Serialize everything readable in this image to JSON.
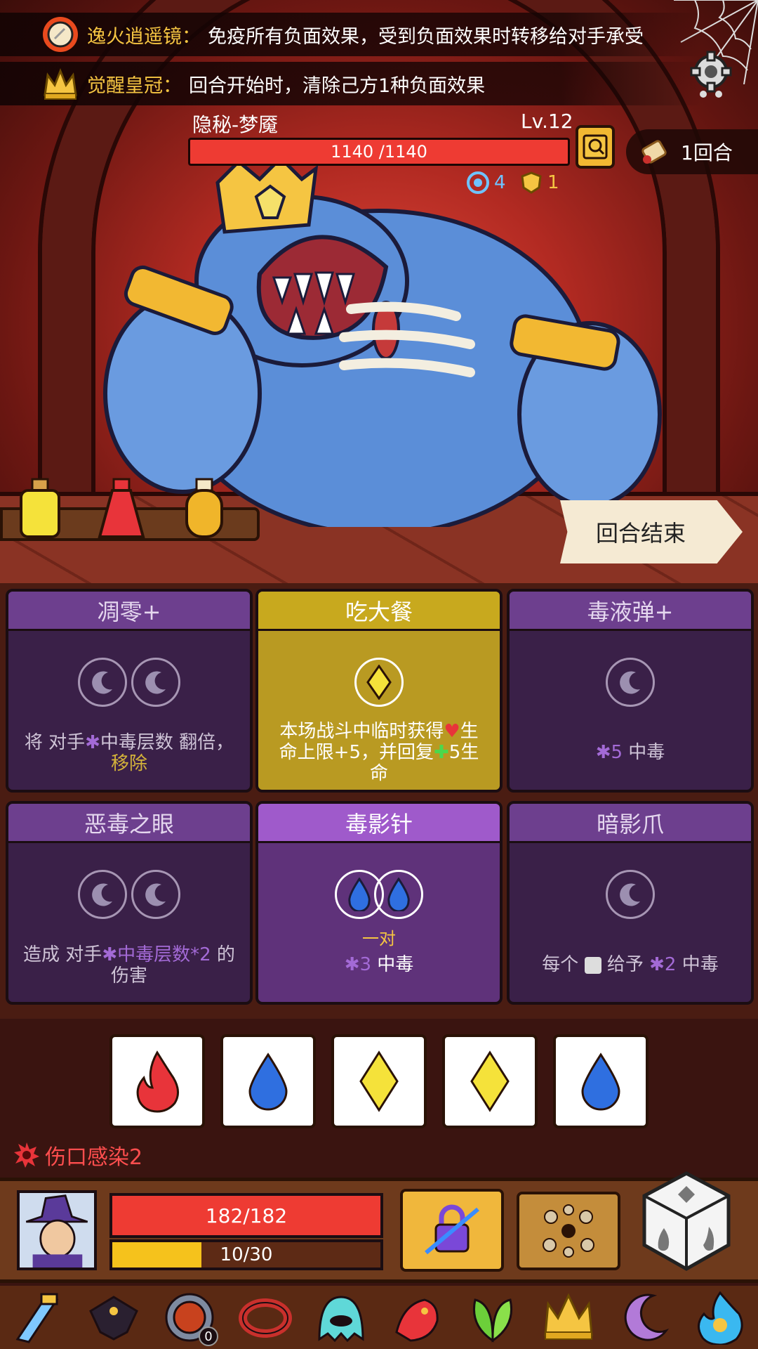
{
  "effects": [
    {
      "name": "逸火逍遥镜：",
      "desc": "免疫所有负面效果，受到负面效果时转移给对手承受",
      "icon": "mirror-icon"
    },
    {
      "name": "觉醒皇冠：",
      "desc": "回合开始时，清除己方1种负面效果",
      "icon": "crown-icon"
    }
  ],
  "enemy": {
    "name": "隐秘-梦魇",
    "level": "Lv.12",
    "hp_text": "1140 /1140",
    "hp": 1140,
    "hp_max": 1140,
    "status": [
      {
        "icon": "target-icon",
        "value": "4"
      },
      {
        "icon": "shield-icon",
        "value": "1"
      }
    ]
  },
  "round": {
    "label": "1回合",
    "icon": "scroll-icon"
  },
  "end_turn_label": "回合结束",
  "potions": [
    {
      "color": "#f5e23a",
      "icon": "yellow-potion-icon"
    },
    {
      "color": "#e8343a",
      "icon": "red-potion-icon"
    },
    {
      "color": "#f0b52a",
      "icon": "orange-potion-icon"
    }
  ],
  "cards": [
    {
      "title": "凋零+",
      "style": "purple",
      "slots": [
        "moon",
        "moon"
      ],
      "desc_parts": [
        "将 对手",
        "中毒层数 翻倍，",
        "移除"
      ]
    },
    {
      "title": "吃大餐",
      "style": "gold",
      "slots": [
        "diamond"
      ],
      "desc_parts": [
        "本场战斗中临时获得",
        "生",
        "命上限+5，并回复",
        "5生",
        "命"
      ]
    },
    {
      "title": "毒液弹+",
      "style": "purple",
      "slots": [
        "moon"
      ],
      "desc_parts": [
        "5",
        "中毒"
      ]
    },
    {
      "title": "恶毒之眼",
      "style": "purple",
      "slots": [
        "moon",
        "moon"
      ],
      "desc_parts": [
        "造成 对手",
        "中毒层数*2",
        "的",
        "伤害"
      ]
    },
    {
      "title": "毒影针",
      "style": "active",
      "slots": [
        "drop",
        "drop"
      ],
      "pair_label": "一对",
      "desc_parts": [
        "3",
        "中毒"
      ]
    },
    {
      "title": "暗影爪",
      "style": "purple",
      "slots": [
        "moon"
      ],
      "desc_parts": [
        "每个",
        "给予",
        "2",
        "中毒"
      ]
    }
  ],
  "dice": [
    "fire",
    "water",
    "diamond",
    "diamond",
    "water"
  ],
  "debuff": {
    "label": "伤口感染2",
    "icon": "wound-icon"
  },
  "player": {
    "hp_text": "182/182",
    "hp": 182,
    "hp_max": 182,
    "energy_text": "10/30",
    "energy": 10,
    "energy_max": 30
  },
  "relics": [
    {
      "icon": "crystal-sword-icon"
    },
    {
      "icon": "dark-bird-icon"
    },
    {
      "icon": "lava-disc-icon",
      "count": "0"
    },
    {
      "icon": "red-bracelet-icon"
    },
    {
      "icon": "ghost-slime-icon"
    },
    {
      "icon": "fire-dragon-icon"
    },
    {
      "icon": "green-leaf-icon"
    },
    {
      "icon": "gold-crown-icon"
    },
    {
      "icon": "crescent-moon-icon"
    },
    {
      "icon": "blue-flame-icon"
    }
  ],
  "colors": {
    "poison": "#a36ad6",
    "gold": "#f5c542",
    "hp_red": "#ee3b33"
  }
}
